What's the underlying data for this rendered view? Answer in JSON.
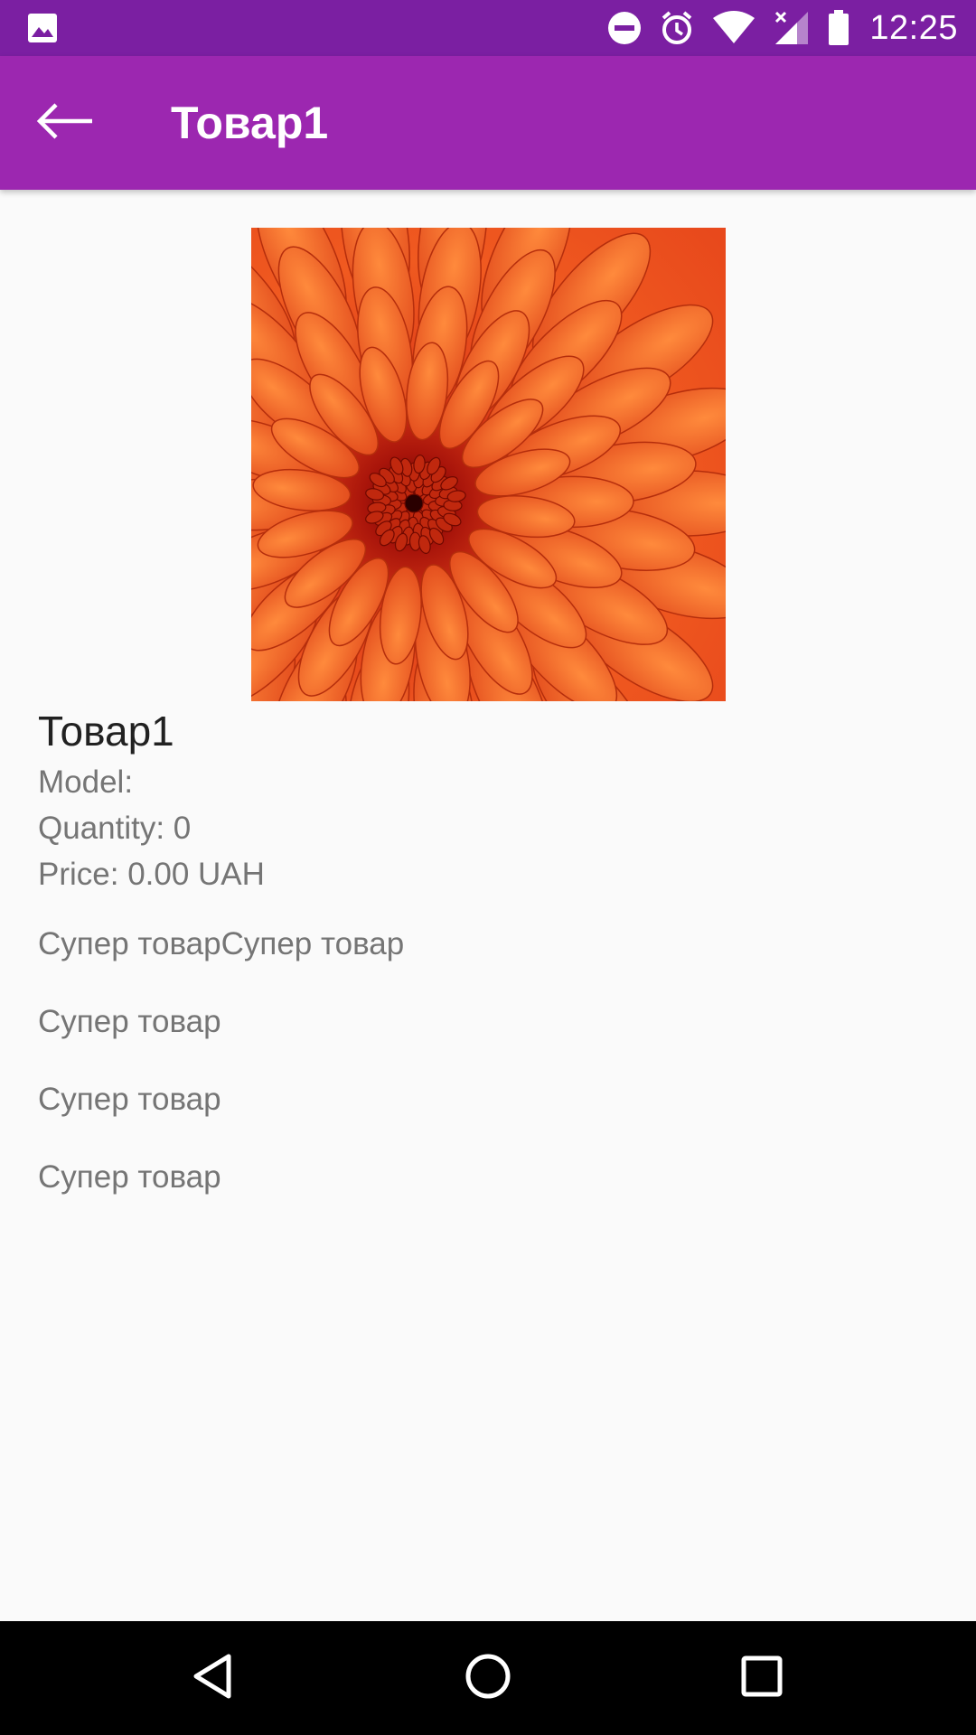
{
  "status_bar": {
    "time": "12:25",
    "icons": [
      "gallery-icon",
      "do-not-disturb-icon",
      "alarm-icon",
      "wifi-icon",
      "signal-icon",
      "battery-icon"
    ]
  },
  "app_bar": {
    "title": "Товар1",
    "back_icon": "arrow-back-icon",
    "background": "#9c27b0",
    "status_background": "#7b1fa2"
  },
  "product": {
    "image": "orange-chrysanthemum-flower",
    "pager_pages": 1,
    "name": "Товар1",
    "model": "Model:",
    "quantity": "Quantity: 0",
    "price": "Price: 0.00 UAH",
    "description": [
      "Супер товарСупер товар",
      "Супер товар",
      "Супер товар",
      "Супер товар"
    ]
  },
  "nav_bar": {
    "buttons": [
      "back-triangle-icon",
      "home-circle-icon",
      "recents-square-icon"
    ]
  }
}
